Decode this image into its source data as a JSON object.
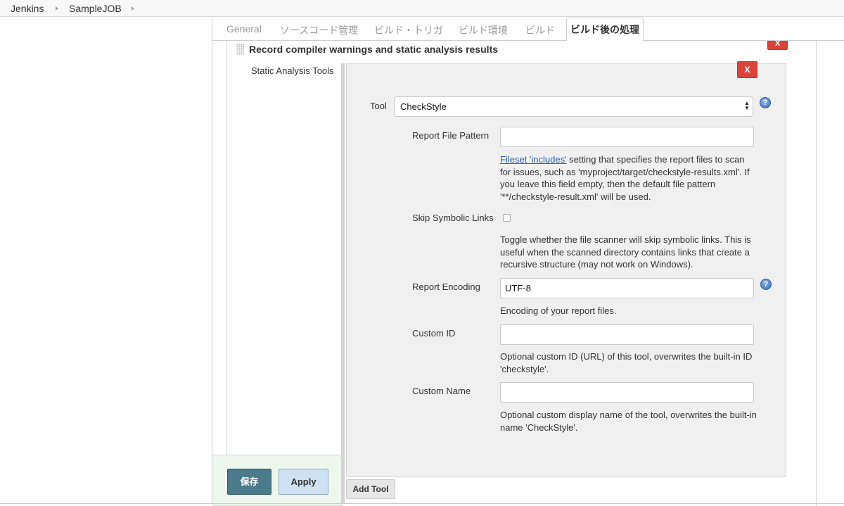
{
  "breadcrumb": {
    "items": [
      "Jenkins",
      "SampleJOB"
    ]
  },
  "tabs": [
    "General",
    "ソースコード管理",
    "ビルド・トリガ",
    "ビルド環境",
    "ビルド",
    "ビルド後の処理"
  ],
  "active_tab": "ビルド後の処理",
  "section": {
    "title": "Record compiler warnings and static analysis results",
    "delete_label": "X",
    "static_tools_label": "Static Analysis Tools"
  },
  "tool": {
    "delete_label": "X",
    "tool_label": "Tool",
    "tool_value": "CheckStyle",
    "help_icon": "?",
    "report_file_pattern_label": "Report File Pattern",
    "report_file_pattern_value": "",
    "report_file_pattern_link": "Fileset 'includes'",
    "report_file_pattern_desc": " setting that specifies the report files to scan for issues, such as 'myproject/target/checkstyle-results.xml'. If you leave this field empty, then the default file pattern '**/checkstyle-result.xml' will be used.",
    "skip_symlinks_label": "Skip Symbolic Links",
    "skip_symlinks_checked": false,
    "skip_symlinks_desc": "Toggle whether the file scanner will skip symbolic links. This is useful when the scanned directory contains links that create a recursive structure (may not work on Windows).",
    "report_encoding_label": "Report Encoding",
    "report_encoding_value": "UTF-8",
    "report_encoding_desc": "Encoding of your report files.",
    "custom_id_label": "Custom ID",
    "custom_id_value": "",
    "custom_id_desc": "Optional custom ID (URL) of this tool, overwrites the built-in ID 'checkstyle'.",
    "custom_name_label": "Custom Name",
    "custom_name_value": "",
    "custom_name_desc": "Optional custom display name of the tool, overwrites the built-in name 'CheckStyle'."
  },
  "add_tool_label": "Add Tool",
  "actions": {
    "save_label": "保存",
    "apply_label": "Apply"
  },
  "colors": {
    "delete": "#d9443a",
    "save": "#4a7a8c",
    "apply": "#cfe2f3",
    "link": "#2a5db0"
  }
}
